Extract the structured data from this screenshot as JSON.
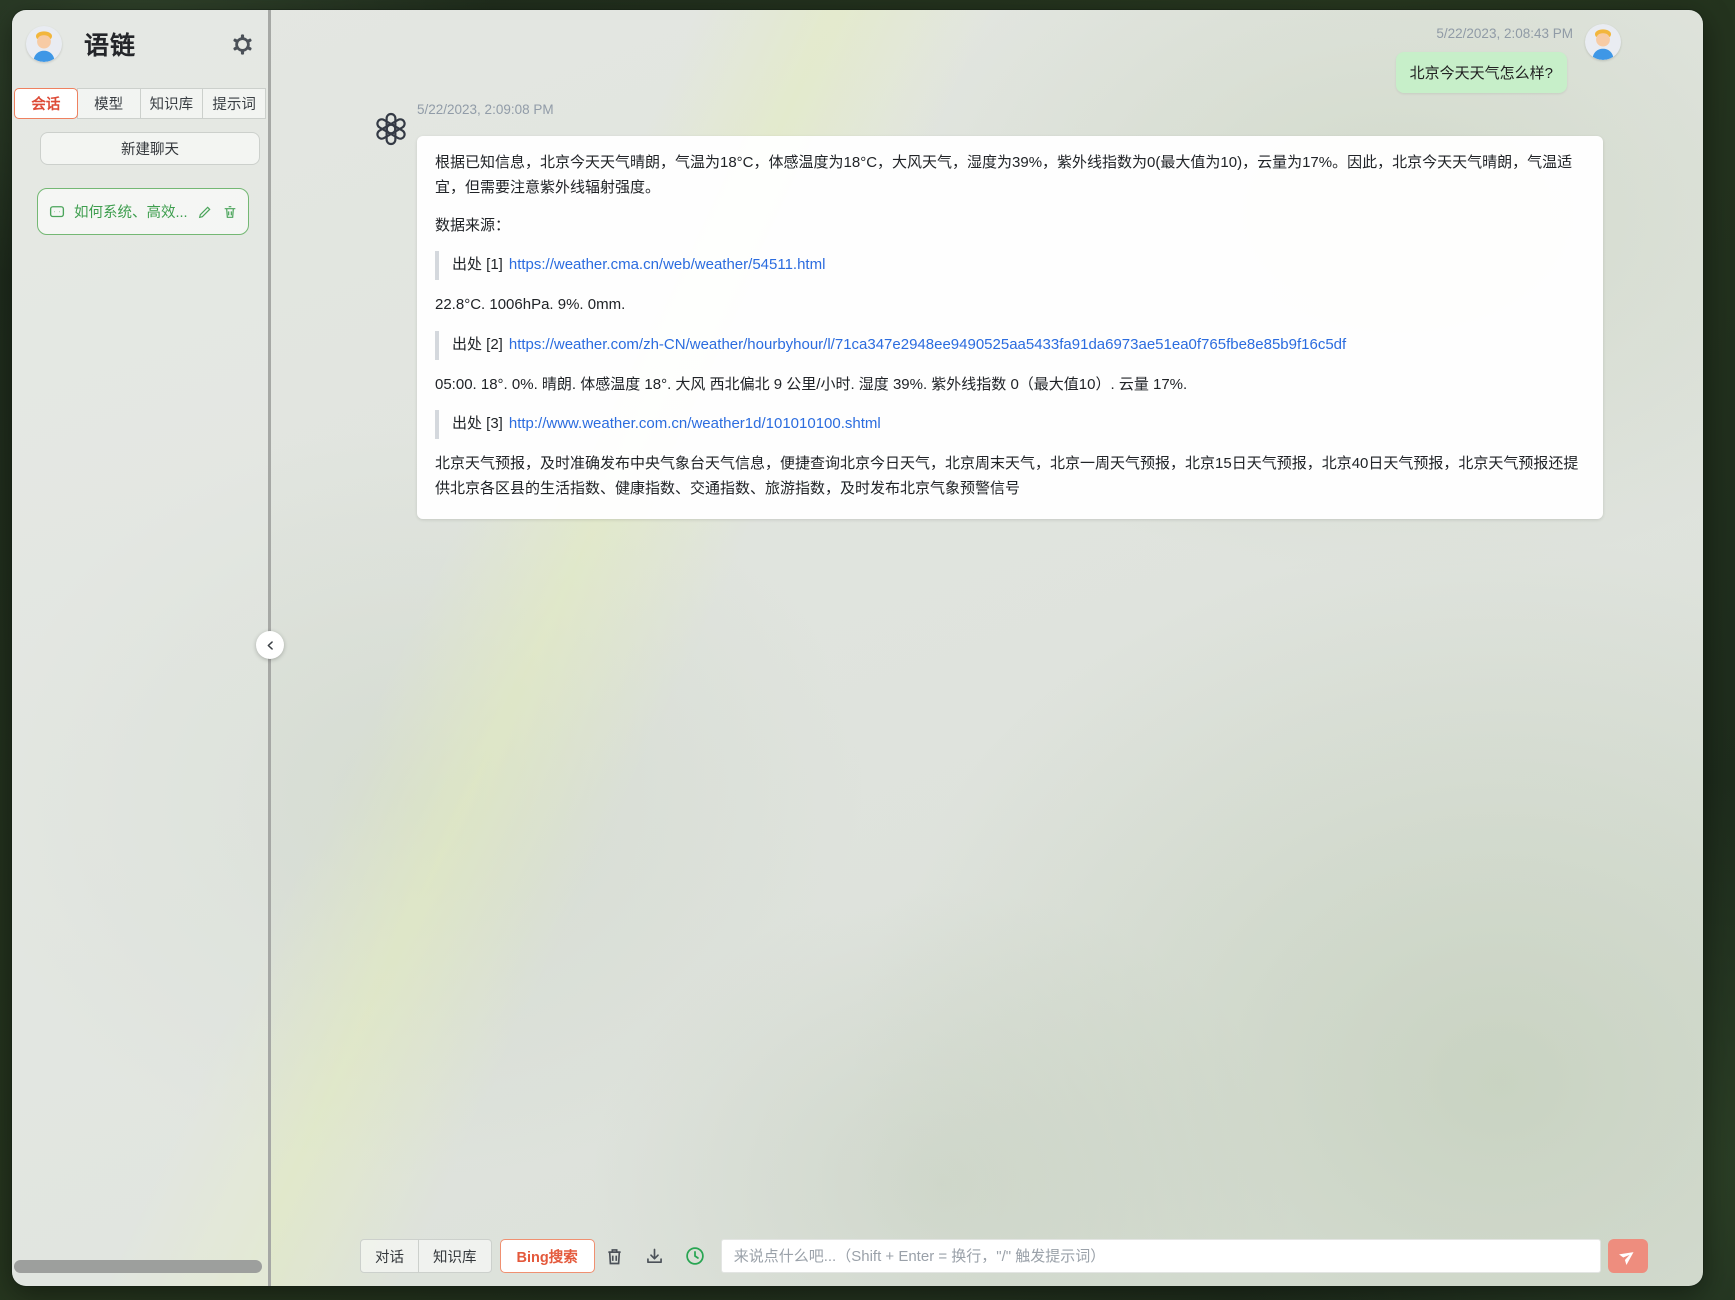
{
  "sidebar": {
    "title": "语链",
    "tabs": [
      {
        "label": "会话",
        "active": true
      },
      {
        "label": "模型",
        "active": false
      },
      {
        "label": "知识库",
        "active": false
      },
      {
        "label": "提示词",
        "active": false
      }
    ],
    "new_chat_label": "新建聊天",
    "chat_item": {
      "title": "如何系统、高效..."
    }
  },
  "chat": {
    "user": {
      "timestamp": "5/22/2023, 2:08:43 PM",
      "text": "北京今天天气怎么样?"
    },
    "assistant": {
      "timestamp": "5/22/2023, 2:09:08 PM",
      "paragraph1": "根据已知信息，北京今天天气晴朗，气温为18°C，体感温度为18°C，大风天气，湿度为39%，紫外线指数为0(最大值为10)，云量为17%。因此，北京今天天气晴朗，气温适宜，但需要注意紫外线辐射强度。",
      "sources_label": "数据来源：",
      "citations": [
        {
          "prefix": "出处 [1]",
          "url": "https://weather.cma.cn/web/weather/54511.html",
          "snippet": "22.8°C. 1006hPa. 9%. 0mm."
        },
        {
          "prefix": "出处 [2]",
          "url": "https://weather.com/zh-CN/weather/hourbyhour/l/71ca347e2948ee9490525aa5433fa91da6973ae51ea0f765fbe8e85b9f16c5df",
          "snippet": "05:00. 18°. 0%. 晴朗. 体感温度 18°. 大风 西北偏北 9 公里/小时. 湿度 39%. 紫外线指数 0（最大值10）. 云量 17%."
        },
        {
          "prefix": "出处 [3]",
          "url": "http://www.weather.com.cn/weather1d/101010100.shtml",
          "snippet": "北京天气预报，及时准确发布中央气象台天气信息，便捷查询北京今日天气，北京周末天气，北京一周天气预报，北京15日天气预报，北京40日天气预报，北京天气预报还提供北京各区县的生活指数、健康指数、交通指数、旅游指数，及时发布北京气象预警信号"
        }
      ]
    }
  },
  "composer": {
    "tabs": [
      {
        "label": "对话",
        "active": false
      },
      {
        "label": "知识库",
        "active": false
      },
      {
        "label": "Bing搜索",
        "active": true
      }
    ],
    "placeholder": "来说点什么吧...（Shift + Enter = 换行，\"/\" 触发提示词）"
  },
  "colors": {
    "accent_red": "#e4593c",
    "accent_green": "#4aa45a",
    "link_blue": "#2b6cdf",
    "user_bubble_green": "#c7efc9",
    "send_button_salmon": "#ee8d7e"
  }
}
